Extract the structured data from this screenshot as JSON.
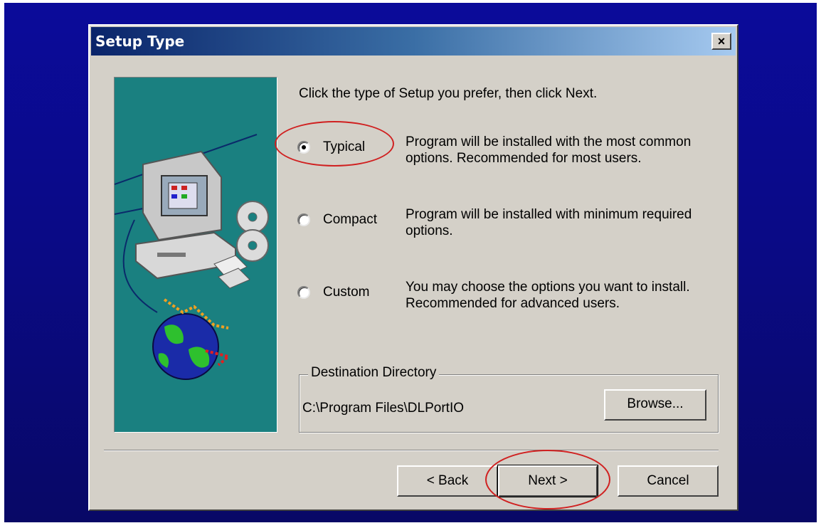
{
  "window": {
    "title": "Setup Type",
    "close_label": "×"
  },
  "prompt": "Click the type of Setup you prefer, then click Next.",
  "options": [
    {
      "label": "Typical",
      "selected": true,
      "description": "Program will be installed with the most common options. Recommended for most users."
    },
    {
      "label": "Compact",
      "selected": false,
      "description": "Program will be installed with minimum required options."
    },
    {
      "label": "Custom",
      "selected": false,
      "description": "You may choose the options you want to install. Recommended for advanced users."
    }
  ],
  "destination": {
    "label": "Destination Directory",
    "path": "C:\\Program Files\\DLPortIO",
    "browse_label": "Browse..."
  },
  "buttons": {
    "back": "< Back",
    "next": "Next >",
    "cancel": "Cancel"
  },
  "colors": {
    "desktop": "#0a0a86",
    "dialog": "#d4d0c8",
    "side_panel": "#1a8080",
    "highlight_circle": "#d02020"
  }
}
